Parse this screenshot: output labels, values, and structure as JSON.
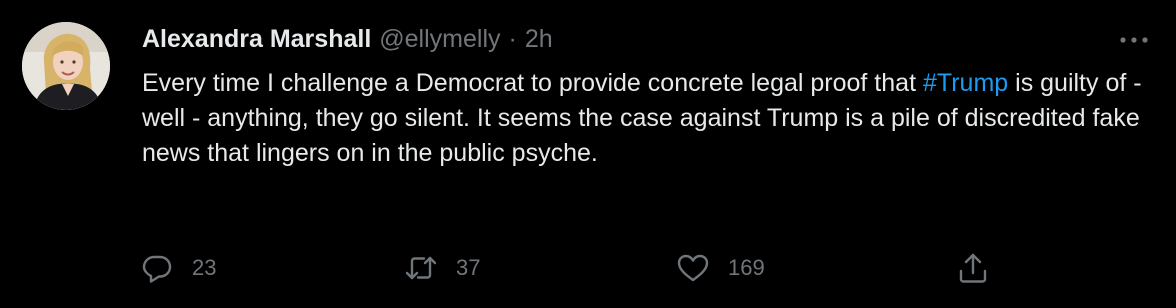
{
  "tweet": {
    "author": {
      "display_name": "Alexandra Marshall",
      "handle": "@ellymelly",
      "separator": "·",
      "time": "2h"
    },
    "text": {
      "before_hashtag": "Every time I challenge a Democrat to provide concrete legal proof that ",
      "hashtag": "#Trump",
      "after_hashtag": " is guilty of - well - anything, they go silent. It seems the case against Trump is a pile of discredited fake news that lingers on in the public psyche."
    },
    "actions": {
      "reply": {
        "icon": "reply-icon",
        "count": "23"
      },
      "retweet": {
        "icon": "retweet-icon",
        "count": "37"
      },
      "like": {
        "icon": "heart-icon",
        "count": "169"
      },
      "share": {
        "icon": "share-icon"
      }
    },
    "more_icon": "more-options-icon"
  },
  "colors": {
    "background": "#000000",
    "text_primary": "#e7e9ea",
    "text_secondary": "#71767b",
    "link": "#1d9bf0"
  }
}
